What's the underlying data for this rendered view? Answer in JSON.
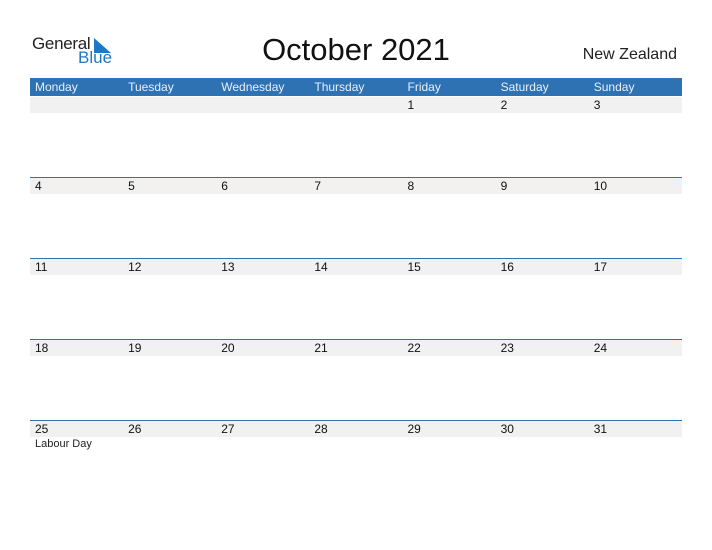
{
  "logo": {
    "line1": "General",
    "line2": "Blue"
  },
  "title": "October 2021",
  "country": "New Zealand",
  "colors": {
    "header": "#2f72b3",
    "strip": "#f1f1f1",
    "logo_blue": "#1e78c8"
  },
  "weekdays": [
    "Monday",
    "Tuesday",
    "Wednesday",
    "Thursday",
    "Friday",
    "Saturday",
    "Sunday"
  ],
  "weeks": [
    {
      "days": [
        "",
        "",
        "",
        "",
        "1",
        "2",
        "3"
      ],
      "events": [
        "",
        "",
        "",
        "",
        "",
        "",
        ""
      ]
    },
    {
      "days": [
        "4",
        "5",
        "6",
        "7",
        "8",
        "9",
        "10"
      ],
      "events": [
        "",
        "",
        "",
        "",
        "",
        "",
        ""
      ]
    },
    {
      "days": [
        "11",
        "12",
        "13",
        "14",
        "15",
        "16",
        "17"
      ],
      "events": [
        "",
        "",
        "",
        "",
        "",
        "",
        ""
      ]
    },
    {
      "days": [
        "18",
        "19",
        "20",
        "21",
        "22",
        "23",
        "24"
      ],
      "events": [
        "",
        "",
        "",
        "",
        "",
        "",
        ""
      ]
    },
    {
      "days": [
        "25",
        "26",
        "27",
        "28",
        "29",
        "30",
        "31"
      ],
      "events": [
        "Labour Day",
        "",
        "",
        "",
        "",
        "",
        ""
      ]
    }
  ]
}
